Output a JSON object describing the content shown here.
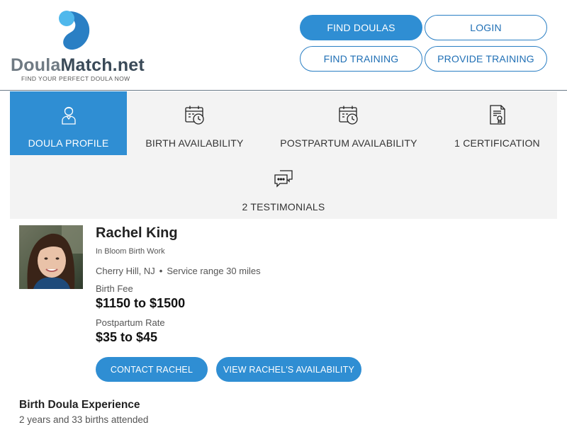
{
  "brand": {
    "name_part1": "Doula",
    "name_part2": "Match.net",
    "tagline": "FIND YOUR PERFECT DOULA NOW",
    "colors": {
      "primary": "#2f8ed3",
      "logo_blue": "#2a7fc4",
      "logo_light": "#4fb8ec"
    }
  },
  "header": {
    "buttons": {
      "find_doulas": "FIND DOULAS",
      "login": "LOGIN",
      "find_training": "FIND TRAINING",
      "provide_training": "PROVIDE TRAINING"
    }
  },
  "tabs": [
    {
      "label": "DOULA PROFILE",
      "icon": "doula-person-icon",
      "active": true
    },
    {
      "label": "BIRTH AVAILABILITY",
      "icon": "calendar-clock-icon",
      "active": false
    },
    {
      "label": "POSTPARTUM AVAILABILITY",
      "icon": "calendar-clock-icon",
      "active": false
    },
    {
      "label": "1 CERTIFICATION",
      "icon": "certificate-icon",
      "active": false
    },
    {
      "label": "2 TESTIMONIALS",
      "icon": "chat-bubbles-icon",
      "active": false
    }
  ],
  "profile": {
    "name": "Rachel King",
    "organization": "In Bloom Birth Work",
    "location": "Cherry Hill, NJ",
    "separator": "•",
    "service_range": "Service range 30 miles",
    "birth_fee_label": "Birth Fee",
    "birth_fee": "$1150 to $1500",
    "postpartum_label": "Postpartum Rate",
    "postpartum_rate": "$35 to $45",
    "contact_button": "CONTACT RACHEL",
    "availability_button": "VIEW RACHEL'S AVAILABILITY"
  },
  "experience": {
    "title": "Birth Doula Experience",
    "text": "2 years and 33 births attended"
  }
}
